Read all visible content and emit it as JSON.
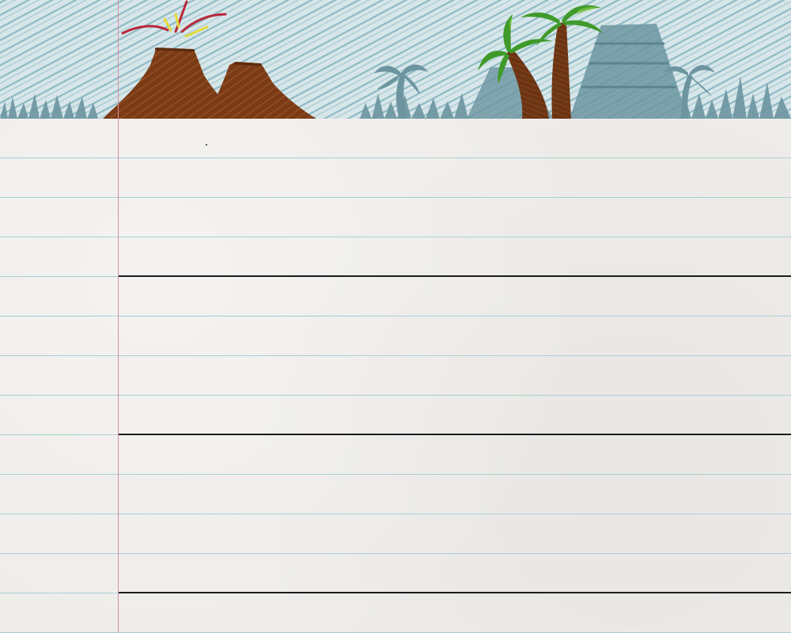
{
  "theme": {
    "paper_color": "#eeece9",
    "rule_color": "#a9cfd4",
    "margin_color": "#d98aa4",
    "writing_line_color": "#1c1c1c",
    "sky_scribble_color": "#7fb3bf",
    "volcano_color": "#7a3b16",
    "lava_color": "#b8283a",
    "spark_color": "#e2da3a",
    "palm_trunk_color": "#6b3413",
    "palm_leaf_color": "#3f9a2a",
    "silhouette_color": "#6c95a0"
  },
  "scene": {
    "illustration": "crayon-prehistoric-landscape",
    "elements": [
      "volcano-icon",
      "palm-tree-icon",
      "pyramid-icon",
      "grass-icon"
    ]
  },
  "ruled_lines": 13,
  "writing_lines": 3
}
